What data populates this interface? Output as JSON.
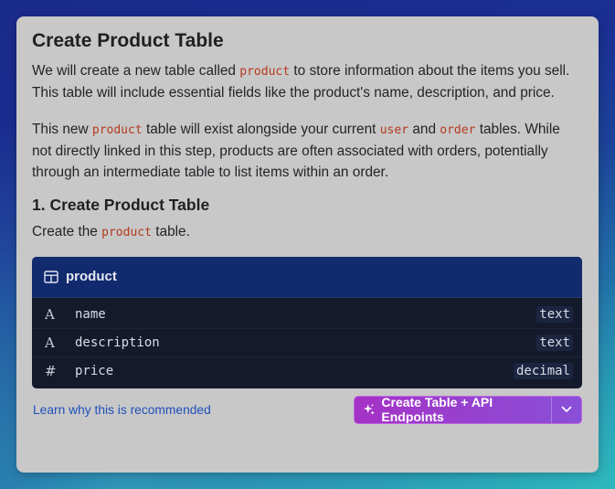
{
  "heading": "Create Product Table",
  "intro": {
    "part1": "We will create a new table called ",
    "code1": "product",
    "part2": " to store information about the items you sell. This table will include essential fields like the product's name, description, and price."
  },
  "context": {
    "part1": "This new ",
    "code1": "product",
    "part2": " table will exist alongside your current ",
    "code2": "user",
    "part3": " and ",
    "code3": "order",
    "part4": " tables. While not directly linked in this step, products are often associated with orders, potentially through an intermediate table to list items within an order."
  },
  "step": {
    "title": "1. Create Product Table",
    "text_part1": "Create the ",
    "text_code": "product",
    "text_part2": " table."
  },
  "table": {
    "name": "product",
    "icon": "table-icon",
    "fields": [
      {
        "icon": "text-type-icon",
        "glyph": "A",
        "name": "name",
        "type": "text"
      },
      {
        "icon": "text-type-icon",
        "glyph": "A",
        "name": "description",
        "type": "text"
      },
      {
        "icon": "number-type-icon",
        "glyph": "#",
        "name": "price",
        "type": "decimal"
      }
    ]
  },
  "footer": {
    "link": "Learn why this is recommended",
    "cta_label": "Create Table + API Endpoints",
    "cta_icon": "sparkle-icon",
    "caret_icon": "chevron-down-icon"
  },
  "colors": {
    "code": "#b53a1c",
    "table_header": "#122a6e",
    "table_body": "#141a2c",
    "link": "#1f4fb8",
    "cta_start": "#a532c6",
    "cta_end": "#8a4fd8"
  }
}
